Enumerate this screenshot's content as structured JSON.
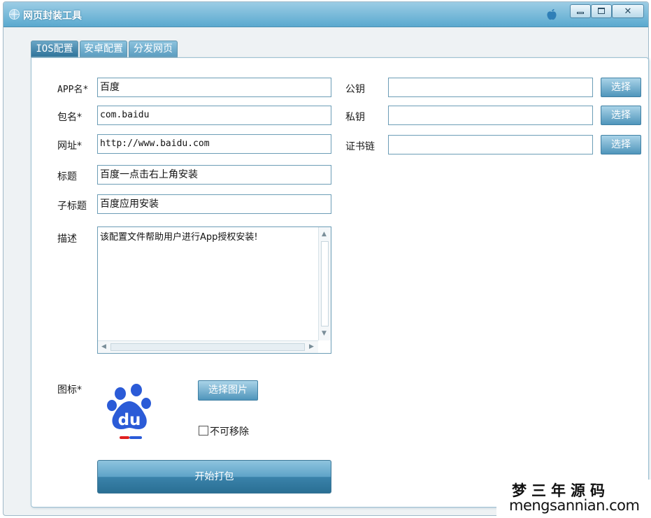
{
  "window": {
    "title": "网页封装工具"
  },
  "tabs": [
    {
      "label": "IOS配置",
      "active": true
    },
    {
      "label": "安卓配置",
      "active": false
    },
    {
      "label": "分发网页",
      "active": false
    }
  ],
  "form": {
    "app_name": {
      "label": "APP名*",
      "value": "百度"
    },
    "package": {
      "label": "包名*",
      "value": "com.baidu"
    },
    "url": {
      "label": "网址*",
      "value": "http://www.baidu.com"
    },
    "title": {
      "label": "标题",
      "value": "百度一点击右上角安装"
    },
    "subtitle": {
      "label": "子标题",
      "value": "百度应用安装"
    },
    "description": {
      "label": "描述",
      "value": "该配置文件帮助用户进行App授权安装!"
    },
    "public_key": {
      "label": "公钥",
      "value": "",
      "button": "选择"
    },
    "private_key": {
      "label": "私钥",
      "value": "",
      "button": "选择"
    },
    "cert_chain": {
      "label": "证书链",
      "value": "",
      "button": "选择"
    },
    "icon": {
      "label": "图标*",
      "pick_button": "选择图片",
      "icon_text": "du"
    },
    "not_removable": {
      "label": "不可移除",
      "checked": false
    },
    "pack_button": "开始打包"
  },
  "watermark": {
    "cn": "梦三年源码",
    "en": "mengsannian.com"
  },
  "colors": {
    "titlebar": "#5aa9cf",
    "accent_button": "#4f95bb",
    "baidu_blue": "#2b5bd7",
    "baidu_red": "#e02020"
  }
}
